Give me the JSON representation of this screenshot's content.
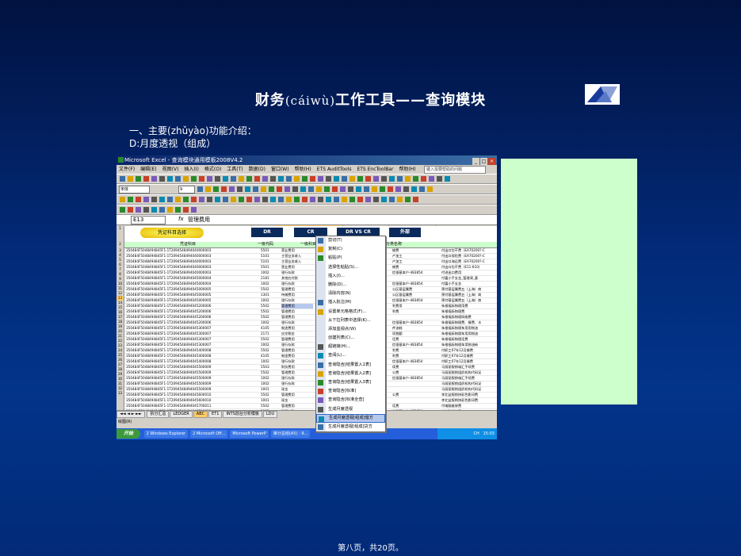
{
  "slide": {
    "title_pre": "财务",
    "title_pinyin": "(cáiwù)",
    "title_post": "工作工具——查询模块",
    "subtitle_pre": "一、主要",
    "subtitle_pinyin": "(zhǔyào)",
    "subtitle_post": "功能介绍：",
    "section": "D:月度透视（组成）",
    "footer": "第八页，共20页。"
  },
  "excel": {
    "window_title": "Microsoft Excel - 查询模块通用模板2008V4.2",
    "menu": [
      "文件(F)",
      "编辑(E)",
      "视图(V)",
      "插入(I)",
      "格式(O)",
      "工具(T)",
      "数据(D)",
      "窗口(W)",
      "帮助(H)",
      "ETS AuditTools",
      "ETS EncToolBar",
      "帮助(H)"
    ],
    "ask_placeholder": "键入需要帮助的问题",
    "font_name": "宋体",
    "font_size": "9",
    "zoom": "100%",
    "name_box": "E13",
    "fx": "fx",
    "formula": "管理费用",
    "columns": [
      "C",
      "D",
      "E",
      "F",
      "G"
    ],
    "pill_button": "凭证科目选择",
    "nav_buttons": [
      "DR",
      "CR",
      "DR VS CR",
      "外部"
    ],
    "headers": {
      "voucher": "凭证科目",
      "code": "一级代码",
      "name": "一级科目",
      "subject": "分类名称"
    },
    "rows": [
      {
        "n": "3",
        "v": "350484F5048494845F1-1T2094548494040000003",
        "c": "5501",
        "s": "营业费用",
        "d": "摊费",
        "e": "付出口包干费（EA70200?-C"
      },
      {
        "n": "4",
        "v": "350484F5048494845F1-1T2094548494040000003",
        "c": "5101",
        "s": "主营业务收入",
        "d": "产加工",
        "e": "付出口保险费（EA70200?-C"
      },
      {
        "n": "5",
        "v": "350484F5048494845F1-1T2094548494040000003",
        "c": "5101",
        "s": "主营业务收入",
        "d": "产加工",
        "e": "付出口海运费（EA70200?-C"
      },
      {
        "n": "6",
        "v": "350484F5048494845F1-1T2094548494040000003",
        "c": "5501",
        "s": "营业费用",
        "d": "摊费",
        "e": "付出口包干费（E11-610）"
      },
      {
        "n": "7",
        "v": "350484F5048494845F1-1T2094548494040000003",
        "c": "1002",
        "s": "银行存款",
        "d": "信银基本户-483854",
        "e": "付进出口费用"
      },
      {
        "n": "8",
        "v": "350484F5048494845F1-1T2094548494045000004",
        "c": "2181",
        "s": "其他应付款",
        "d": "",
        "e": "付嘉小手支金_管理津_基"
      },
      {
        "n": "9",
        "v": "350484F5048494845F1-1T2094548494045000004",
        "c": "1002",
        "s": "银行存款",
        "d": "信银基本户-483854",
        "e": "付嘉小手支金"
      },
      {
        "n": "10",
        "v": "350484F5048494845F1-1T2094548494045000005",
        "c": "5502",
        "s": "管理费用",
        "d": "公区基层属费",
        "e": "预付基层属费五（上海）商"
      },
      {
        "n": "11",
        "v": "350484F5048494845F1-1T2094548494045000005",
        "c": "1301",
        "s": "待摊费用",
        "d": "公区基层属费",
        "e": "预付基层属费五（上海）商"
      },
      {
        "n": "12",
        "v": "350484F5048494845F1-1T2094548494045000005",
        "c": "1002",
        "s": "银行存款",
        "d": "信银基本户-483854",
        "e": "预付基层属费五（上海）商"
      },
      {
        "n": "13",
        "v": "350484F5048494845F1-1T2094548494045200006",
        "c": "5502",
        "s": "管理费用",
        "d": "利费用",
        "e": "朱根福拆物理用费",
        "sel": true
      },
      {
        "n": "14",
        "v": "350484F5048494845F1-1T2094548494045200006",
        "c": "5502",
        "s": "管理费用",
        "d": "利费",
        "e": "朱根福拆物理费"
      },
      {
        "n": "15",
        "v": "350484F5048494845F1-1T2094548494045200006",
        "c": "5502",
        "s": "管理费用",
        "d": "",
        "e": "朱根福拆物理网络费"
      },
      {
        "n": "16",
        "v": "350484F5048494845F1-1T2094548494045200006",
        "c": "1002",
        "s": "银行存款",
        "d": "信银基本户-483854",
        "e": "朱根福拆物理费、餐费、丰"
      },
      {
        "n": "17",
        "v": "350484F5048494845F1-1T2094548494045300007",
        "c": "4105",
        "s": "制造费用",
        "d": "件油耗",
        "e": "朱根福拆物理车用用物油"
      },
      {
        "n": "18",
        "v": "350484F5048494845F1-1T2094548494045300007",
        "c": "2171",
        "s": "应交税金",
        "d": "项税额",
        "e": "朱根福拆物理车用用物油"
      },
      {
        "n": "19",
        "v": "350484F5048494845F1-1T2094548494045300007",
        "c": "5502",
        "s": "管理费用",
        "d": "话费",
        "e": "朱根福拆物理话费"
      },
      {
        "n": "20",
        "v": "350484F5048494845F1-1T2094548494045300007",
        "c": "1002",
        "s": "银行存款",
        "d": "信银基本户-483854",
        "e": "朱根福拆物理车用物油新"
      },
      {
        "n": "21",
        "v": "350484F5048494845F1-1T2094548494045400008",
        "c": "5502",
        "s": "管理费用",
        "d": "利费",
        "e": "付职工07年12月餐费"
      },
      {
        "n": "22",
        "v": "350484F5048494845F1-1T2094548494045400008",
        "c": "4105",
        "s": "制造费用",
        "d": "利费",
        "e": "付职工07年12月餐费"
      },
      {
        "n": "23",
        "v": "350484F5048494845F1-1T2094548494045400008",
        "c": "1002",
        "s": "银行存款",
        "d": "信银基本户-483854",
        "e": "付职工07年12月餐费"
      },
      {
        "n": "24",
        "v": "350484F5048494845F1-1T2094548494045500009",
        "c": "5503",
        "s": "财务费用",
        "d": "续费",
        "e": "马丽丽报销电汇手续费"
      },
      {
        "n": "25",
        "v": "350484F5048494845F1-1T2094548494045500009",
        "c": "5502",
        "s": "管理费用",
        "d": "公费",
        "e": "马丽丽报销组织机构代码证"
      },
      {
        "n": "26",
        "v": "350484F5048494845F1-1T2094548494045500009",
        "c": "1002",
        "s": "银行存款",
        "d": "信银基本户-483854",
        "e": "马丽丽报销电汇手续费"
      },
      {
        "n": "27",
        "v": "350484F5048494845F1-1T2094548494045500009",
        "c": "1002",
        "s": "银行存款",
        "d": "",
        "e": "马丽丽报销组织机构代码证"
      },
      {
        "n": "28",
        "v": "350484F5048494845F1-1T2094548494045500009",
        "c": "1001",
        "s": "现金",
        "d": "",
        "e": "马丽丽报销组织机构代码证"
      },
      {
        "n": "29",
        "v": "350484F5048494845F1-1T2094548494045600010",
        "c": "5502",
        "s": "管理费用",
        "d": "公费",
        "e": "李北益报销快彩色影印费"
      },
      {
        "n": "30",
        "v": "350484F5048494845F1-1T2094548494045600010",
        "c": "1001",
        "s": "现金",
        "d": "",
        "e": "李北益报销快彩色影印费"
      },
      {
        "n": "31",
        "v": "350484F5048494845F1-1T2094548494045700011",
        "c": "5502",
        "s": "管理费用",
        "d": "话费",
        "e": "付电脑维修费"
      },
      {
        "n": "32",
        "v": "350484F5048494845F1-1T2094548494045700011",
        "c": "1002",
        "s": "银行存款",
        "d": "信银基本户-483854",
        "e": "付电脑维修费"
      },
      {
        "n": "33",
        "v": "350484F5048494845F1-1T2094548494045800012",
        "c": "5502",
        "s": "管理费用",
        "d": "利费",
        "e": "付公司07年12月邮费"
      }
    ],
    "sheet_tabs": [
      "拆分汇总",
      "LEDGER",
      "ABC",
      "ET1",
      "INTS前台分析模板",
      "LDU"
    ],
    "draw_label": "绘图(R)",
    "taskbar": {
      "start": "开始",
      "tasks": [
        "2 Windows Explorer",
        "2 Microsoft Off...",
        "Microsoft PowerP",
        "审计总结(A5) - 9..."
      ],
      "time": "15:03",
      "lang": "CH"
    }
  },
  "context_menu": {
    "items": [
      {
        "label": "剪切(T)",
        "icon": "scissors-icon",
        "hl": false
      },
      {
        "label": "复制(C)",
        "icon": "copy-icon",
        "hl": false
      },
      {
        "label": "粘贴(P)",
        "icon": "paste-icon",
        "hl": false
      },
      {
        "label": "选择性粘贴(S)...",
        "icon": "",
        "hl": false
      },
      {
        "label": "插入(I)...",
        "icon": "",
        "hl": false
      },
      {
        "label": "删除(D)...",
        "icon": "",
        "hl": false
      },
      {
        "label": "清除内容(N)",
        "icon": "",
        "hl": false
      },
      {
        "label": "插入批注(M)",
        "icon": "comment-icon",
        "hl": false
      },
      {
        "label": "设置单元格格式(F)...",
        "icon": "format-icon",
        "hl": false
      },
      {
        "label": "从下拉列表中选择(K)...",
        "icon": "",
        "hl": false
      },
      {
        "label": "添加监视点(W)",
        "icon": "",
        "hl": false
      },
      {
        "label": "创建列表(C)...",
        "icon": "",
        "hl": false
      },
      {
        "label": "超链接(H)...",
        "icon": "hyperlink-icon",
        "hl": false
      },
      {
        "label": "查阅(L)...",
        "icon": "lookup-icon",
        "hl": false
      },
      {
        "label": "查询隐含[结果置入1表]",
        "icon": "query-icon",
        "hl": false
      },
      {
        "label": "查询隐含[结果置入2表]",
        "icon": "query-icon",
        "hl": false
      },
      {
        "label": "查询隐含[结果置入3表]",
        "icon": "query-icon",
        "hl": false
      },
      {
        "label": "查询隐含[标准]",
        "icon": "query-icon",
        "hl": false
      },
      {
        "label": "查询隐含[标准全查]",
        "icon": "query-icon",
        "hl": false
      },
      {
        "label": "生成月度透视",
        "icon": "pivot-icon",
        "hl": false
      },
      {
        "label": "生成月度透视[组成]借方",
        "icon": "pivot-icon",
        "hl": true
      },
      {
        "label": "生成月度透视[组成]贷方",
        "icon": "pivot-icon",
        "hl": false
      }
    ]
  },
  "colors": {
    "slide_bg": "#022a78",
    "panel": "#ccffcc",
    "menu_highlight": "#b6c8ee",
    "nav_button": "#0b2a5c"
  }
}
